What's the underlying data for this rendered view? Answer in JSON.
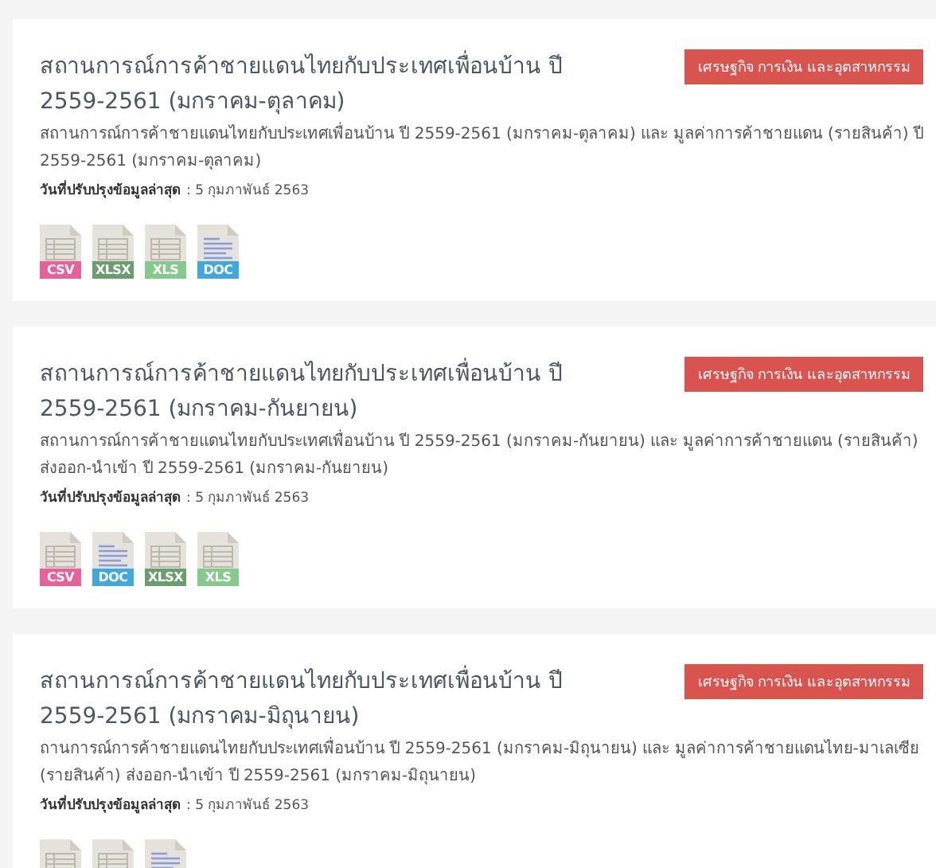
{
  "datasets": [
    {
      "title": "สถานการณ์การค้าชายแดนไทยกับประเทศเพื่อนบ้าน ปี 2559-2561 (มกราคม-ตุลาคม)",
      "category": "เศรษฐกิจ การเงิน และอุตสาหกรรม",
      "description": "สถานการณ์การค้าชายแดนไทยกับประเทศเพื่อนบ้าน ปี 2559-2561 (มกราคม-ตุลาคม) และ มูลค่าการค้าชายแดน (รายสินค้า) ปี 2559-2561 (มกราคม-ตุลาคม)",
      "updated_label": "วันที่ปรับปรุงข้อมูลล่าสุด",
      "updated_date": ": 5 กุมภาพันธ์ 2563",
      "files": [
        {
          "kind": "sheet",
          "label": "CSV",
          "color": "#e8609a"
        },
        {
          "kind": "sheet",
          "label": "XLSX",
          "color": "#6a9e6f"
        },
        {
          "kind": "sheet",
          "label": "XLS",
          "color": "#86c98c"
        },
        {
          "kind": "doc",
          "label": "DOC",
          "color": "#3fa9dc"
        }
      ]
    },
    {
      "title": "สถานการณ์การค้าชายแดนไทยกับประเทศเพื่อนบ้าน ปี 2559-2561 (มกราคม-กันยายน)",
      "category": "เศรษฐกิจ การเงิน และอุตสาหกรรม",
      "description": "สถานการณ์การค้าชายแดนไทยกับประเทศเพื่อนบ้าน ปี 2559-2561 (มกราคม-กันยายน) และ มูลค่าการค้าชายแดน (รายสินค้า) ส่งออก-นำเข้า ปี 2559-2561 (มกราคม-กันยายน)",
      "updated_label": "วันที่ปรับปรุงข้อมูลล่าสุด",
      "updated_date": ": 5 กุมภาพันธ์ 2563",
      "files": [
        {
          "kind": "sheet",
          "label": "CSV",
          "color": "#e8609a"
        },
        {
          "kind": "doc",
          "label": "DOC",
          "color": "#3fa9dc"
        },
        {
          "kind": "sheet",
          "label": "XLSX",
          "color": "#6a9e6f"
        },
        {
          "kind": "sheet",
          "label": "XLS",
          "color": "#86c98c"
        }
      ]
    },
    {
      "title": "สถานการณ์การค้าชายแดนไทยกับประเทศเพื่อนบ้าน ปี 2559-2561 (มกราคม-มิถุนายน)",
      "category": "เศรษฐกิจ การเงิน และอุตสาหกรรม",
      "description": "ถานการณ์การค้าชายแดนไทยกับประเทศเพื่อนบ้าน ปี 2559-2561 (มกราคม-มิถุนายน) และ มูลค่าการค้าชายแดนไทย-มาเลเซีย (รายสินค้า) ส่งออก-นำเข้า  ปี 2559-2561 (มกราคม-มิถุนายน)",
      "updated_label": "วันที่ปรับปรุงข้อมูลล่าสุด",
      "updated_date": ": 5 กุมภาพันธ์ 2563",
      "files": [
        {
          "kind": "sheet"
        },
        {
          "kind": "sheet"
        },
        {
          "kind": "doc"
        }
      ]
    }
  ]
}
